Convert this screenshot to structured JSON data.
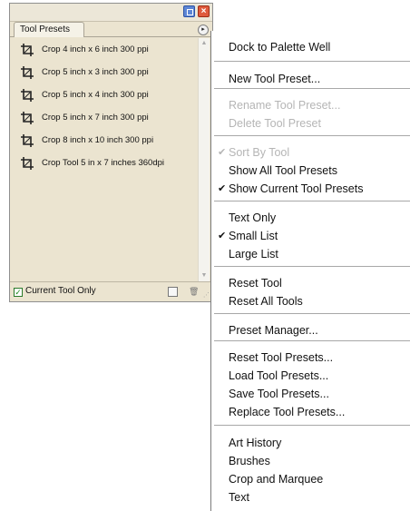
{
  "palette": {
    "tab_label": "Tool Presets",
    "items": [
      "Crop 4 inch x 6 inch 300 ppi",
      "Crop 5 inch x 3 inch 300 ppi",
      "Crop 5 inch x 4 inch 300 ppi",
      "Crop 5 inch x 7 inch 300 ppi",
      "Crop 8 inch x 10 inch 300 ppi",
      "Crop Tool 5 in x 7 inches 360dpi"
    ],
    "current_tool_only_label": "Current Tool Only",
    "current_tool_only_checked": true,
    "close_glyph": "×",
    "check_glyph": "✓",
    "menu_arrow_glyph": "▸",
    "trash_glyph": "🗑",
    "scroll_up_glyph": "▲",
    "scroll_down_glyph": "▼",
    "grip_glyph": "⋰"
  },
  "menu": {
    "items": [
      {
        "label": "Dock to Palette Well",
        "disabled": false,
        "checked": false
      },
      {
        "label": "New Tool Preset...",
        "disabled": false,
        "checked": false
      },
      {
        "label": "Rename Tool Preset...",
        "disabled": true,
        "checked": false
      },
      {
        "label": "Delete Tool Preset",
        "disabled": true,
        "checked": false
      },
      {
        "label": "Sort By Tool",
        "disabled": true,
        "checked": true
      },
      {
        "label": "Show All Tool Presets",
        "disabled": false,
        "checked": false
      },
      {
        "label": "Show Current Tool Presets",
        "disabled": false,
        "checked": true
      },
      {
        "label": "Text Only",
        "disabled": false,
        "checked": false
      },
      {
        "label": "Small List",
        "disabled": false,
        "checked": true
      },
      {
        "label": "Large List",
        "disabled": false,
        "checked": false
      },
      {
        "label": "Reset Tool",
        "disabled": false,
        "checked": false
      },
      {
        "label": "Reset All Tools",
        "disabled": false,
        "checked": false
      },
      {
        "label": "Preset Manager...",
        "disabled": false,
        "checked": false
      },
      {
        "label": "Reset Tool Presets...",
        "disabled": false,
        "checked": false
      },
      {
        "label": "Load Tool Presets...",
        "disabled": false,
        "checked": false
      },
      {
        "label": "Save Tool Presets...",
        "disabled": false,
        "checked": false
      },
      {
        "label": "Replace Tool Presets...",
        "disabled": false,
        "checked": false
      },
      {
        "label": "Art History",
        "disabled": false,
        "checked": false
      },
      {
        "label": "Brushes",
        "disabled": false,
        "checked": false
      },
      {
        "label": "Crop and Marquee",
        "disabled": false,
        "checked": false
      },
      {
        "label": "Text",
        "disabled": false,
        "checked": false
      }
    ],
    "check_glyph": "✔"
  },
  "colors": {
    "palette_bg": "#ebe4d0",
    "close_button": "#df5a3c",
    "minimize_button": "#5d86d5",
    "disabled_text": "#b5b5b5"
  }
}
